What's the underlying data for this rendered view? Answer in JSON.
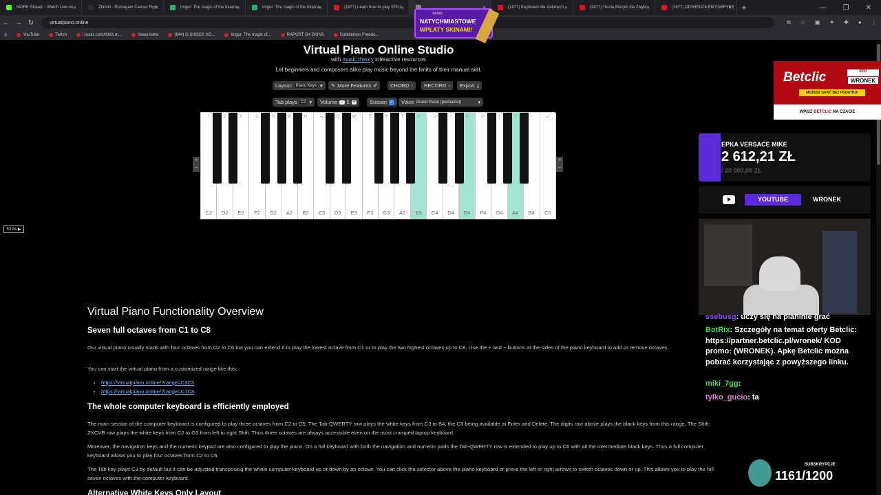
{
  "browser": {
    "tabs": [
      {
        "title": "MORK Stream - Watch Live on",
        "active": false
      },
      {
        "title": "Zbiórki - Pomagam Cancer Figh",
        "active": false
      },
      {
        "title": "Imgur: The magic of the Interne",
        "active": false
      },
      {
        "title": "Imgur: The magic of the Interne",
        "active": false
      },
      {
        "title": "(1677) Learn how to play STILL",
        "active": false
      },
      {
        "title": "",
        "active": true
      },
      {
        "title": "(1677) Keyboard dla zielonych",
        "active": false
      },
      {
        "title": "(1677) Teoria Muzyki dla Zwykł",
        "active": false
      },
      {
        "title": "(1677) ODWIEDZIŁEM FABRYKĘ",
        "active": false
      }
    ],
    "url": "virtualpiano.online",
    "bookmarks": [
      "YouTube",
      "Twitch",
      "i.nuuls.com/lhhiX.m...",
      "Nowa karta",
      "(644) G SHOCK HO...",
      "Imgur: The magic of...",
      "RAPORT G4 SKINS",
      "Cobblemon Freedo..."
    ]
  },
  "site": {
    "title": "Virtual Piano Online Studio",
    "subtitle_pre": "with ",
    "subtitle_link": "music theory",
    "subtitle_post": " interactive resources",
    "tagline": "Let beginners and composers alike play music beyond the limits of their manual skill."
  },
  "controls": {
    "layout_label": "Layout:",
    "layout_value": "Piano Keys",
    "more_features": "More Features",
    "chord": "CHORD",
    "record": "RECORD",
    "export": "Export",
    "tab_plays_label": "Tab plays",
    "tab_plays_value": "C3",
    "volume_label": "Volume",
    "volume_minus": "−",
    "volume_value": "5",
    "volume_plus": "+",
    "sustain_label": "Sustain",
    "voice_label": "Voice",
    "voice_value": "Grand Piano (preloaded)"
  },
  "piano": {
    "white_keys": [
      {
        "note": "C2",
        "code": "!",
        "highlighted": false
      },
      {
        "note": "D2",
        "code": "Z",
        "highlighted": false
      },
      {
        "note": "E2",
        "code": "X",
        "highlighted": false
      },
      {
        "note": "F2",
        "code": "C",
        "highlighted": false
      },
      {
        "note": "G2",
        "code": "V",
        "highlighted": false
      },
      {
        "note": "A2",
        "code": "B",
        "highlighted": false
      },
      {
        "note": "B2",
        "code": "N",
        "highlighted": false
      },
      {
        "note": "C3",
        "code": "⇆",
        "highlighted": false
      },
      {
        "note": "D3",
        "code": "Q",
        "highlighted": false
      },
      {
        "note": "E3",
        "code": "W",
        "highlighted": false
      },
      {
        "note": "F3",
        "code": "E",
        "highlighted": false
      },
      {
        "note": "G3",
        "code": "R",
        "highlighted": false
      },
      {
        "note": "A3",
        "code": "T",
        "highlighted": false
      },
      {
        "note": "B3",
        "code": "Y",
        "highlighted": true
      },
      {
        "note": "C4",
        "code": "U",
        "highlighted": false
      },
      {
        "note": "D4",
        "code": "I",
        "highlighted": false
      },
      {
        "note": "E4",
        "code": "O",
        "highlighted": true
      },
      {
        "note": "F4",
        "code": "P",
        "highlighted": false
      },
      {
        "note": "G4",
        "code": "[",
        "highlighted": false
      },
      {
        "note": "A4",
        "code": "]",
        "highlighted": true
      },
      {
        "note": "B4",
        "code": "\\",
        "highlighted": false
      },
      {
        "note": "C5",
        "code": "↵",
        "highlighted": false
      }
    ],
    "black_keys": [
      {
        "code": "",
        "after": 0
      },
      {
        "code": "",
        "after": 1
      },
      {
        "code": "",
        "after": 3
      },
      {
        "code": "",
        "after": 4
      },
      {
        "code": "",
        "after": 5
      },
      {
        "code": "",
        "after": 7
      },
      {
        "code": "",
        "after": 8
      },
      {
        "code": "",
        "after": 10
      },
      {
        "code": "",
        "after": 11
      },
      {
        "code": "",
        "after": 12
      },
      {
        "code": "",
        "after": 14
      },
      {
        "code": "",
        "after": 15
      },
      {
        "code": "",
        "after": 17
      },
      {
        "code": "",
        "after": 18
      },
      {
        "code": "",
        "after": 19
      }
    ],
    "left_plus": "+",
    "left_minus": "−",
    "right_plus": "+",
    "right_minus": "−"
  },
  "zoom_pill": "53.8s ▶",
  "content": {
    "overview_title": "Virtual Piano Functionality Overview",
    "h_octaves": "Seven full octaves from C1 to C8",
    "p_octaves": "Our virtual piano usually starts with four octaves from C2 to C6 but you can extend it to play the lowest octave from C1 or to play the two highest octaves up to C8. Use the + and − buttons at the sides of the piano keyboard to add or remove octaves.",
    "p_range": "You can start the virtual piano from a customized range like this:",
    "links": [
      "https://virtualpiano.online/?range=C3C5",
      "https://virtualpiano.online/?range=C1C8"
    ],
    "h_keyboard": "The whole computer keyboard is efficiently employed",
    "p_keyboard1": "The main section of the computer keyboard is configured to play three octaves from C2 to C5. The Tab-QWERTY row plays the white keys from C3 to B4, the C5 being available at Enter and Delete. The digits row above plays the black keys from this range. The Shift-ZXCVB row plays the white keys from C2 to G3 from left to right Shift. Thus three octaves are always accessible even on the most cramped laptop keyboard.",
    "p_keyboard2": "Moreover, the navigation keys and the numeric keypad are also configured to play the piano. On a full keyboard with both the navigation and numeric pads the Tab-QWERTY row is extended to play up to C6 with all the intermediate black keys. Thus a full computer keyboard allows you to play four octaves from C2 to C6.",
    "p_keyboard3": "The Tab key plays C3 by default but it can be adjusted transposing the whole computer keyboard up or down by an octave. You can click the selector above the piano keyboard or press the left or right arrows to switch octaves down or up. This allows you to play the full seven octaves with the computer keyboard.",
    "h_alt": "Alternative White Keys Only Layout"
  },
  "overlay": {
    "ad": {
      "brand": "Betclic",
      "kod_label": "KOD",
      "code": "WRONEK",
      "promo": "MOŻESZ GRAĆ BEZ PODATKU!",
      "footer_pre": "WPISZ ",
      "footer_brand": "BETCLIC",
      "footer_post": " NA CZACIE"
    },
    "donation": {
      "label": "EPKA VERSACE MIKE",
      "amount": "2 612,21 ZŁ",
      "goal": "/ 20 000,00 ZŁ",
      "progress": 0.1306
    },
    "socials": {
      "youtube": "YOUTUBE",
      "channel": "WRONEK"
    },
    "chat": [
      {
        "user": "ssebusg",
        "text": "uczy się na pianinie grać",
        "color": "purple"
      },
      {
        "user": "BotRix",
        "text": "Szczegóły na temat oferty Betclic: https://partner.betclic.pl/wronek/ KOD promo: (WRONEK). Apkę Betclic można pobrać korzystając z powyższego linku.",
        "color": "green"
      },
      {
        "user": "miki_7gg",
        "text": "",
        "color": "green"
      },
      {
        "user": "tylko_gucio",
        "text": "ta",
        "color": "pink"
      }
    ],
    "subs": {
      "label": "SUBSKRYPCJE",
      "count": "1161/1200"
    },
    "banner": {
      "small": "SKINS",
      "line1": "NATYCHMIASTOWE",
      "line2": "WPŁATY SKINAMI!"
    }
  }
}
